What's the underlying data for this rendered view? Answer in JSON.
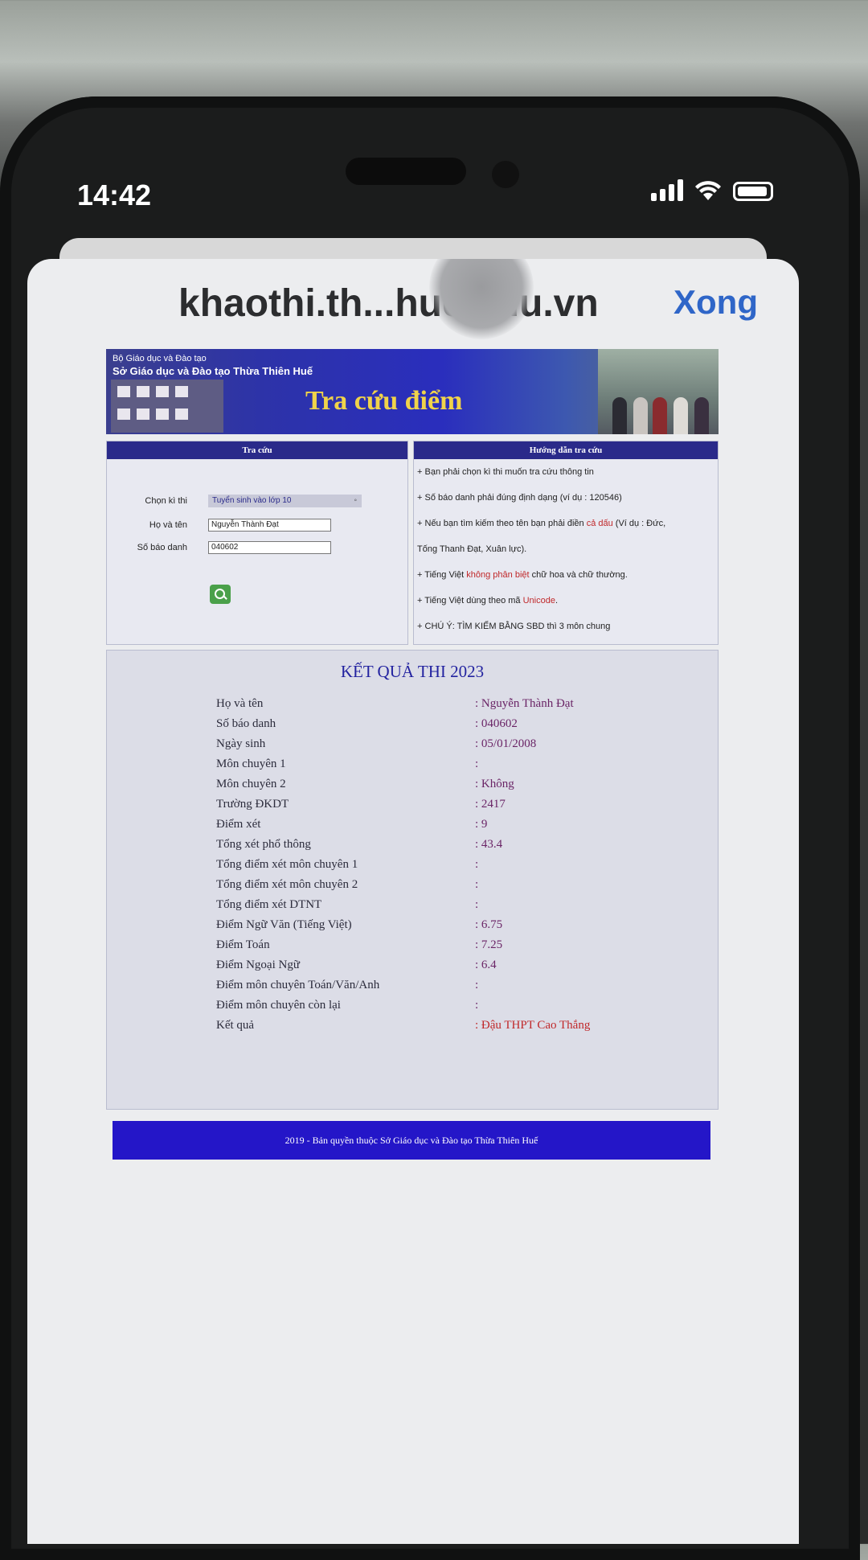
{
  "status_bar": {
    "time": "14:42"
  },
  "browser": {
    "url": "khaothi.th...hue.edu.vn",
    "done_label": "Xong"
  },
  "banner": {
    "ministry": "Bộ Giáo dục và  Đào tạo",
    "department": "Sở Giáo dục và Đào tạo Thừa Thiên Huế",
    "title": "Tra cứu điểm"
  },
  "search": {
    "header": "Tra cứu",
    "exam_label": "Chọn kì thi",
    "exam_value": "Tuyển sinh vào lớp 10",
    "name_label": "Họ và tên",
    "name_value": "Nguyễn Thành Đạt",
    "sbd_label": "Số báo danh",
    "sbd_value": "040602"
  },
  "guide": {
    "header": "Hướng dẫn tra cứu",
    "line1": "+ Bạn phải chọn kì thi muốn tra cứu thông tin",
    "line2": "+ Số báo danh phải đúng định dạng (ví dụ : 120546)",
    "line3a": "+ Nếu bạn tìm kiếm theo tên bạn phải điền ",
    "line3b": "cả dấu",
    "line3c": " (Ví dụ : Đức,",
    "line4": "Tống Thanh Đạt, Xuân lực).",
    "line5a": "+ Tiếng Việt ",
    "line5b": "không phân biệt",
    "line5c": " chữ hoa và chữ thường.",
    "line6a": "+ Tiếng Việt dùng theo mã ",
    "line6b": "Unicode",
    "line6c": ".",
    "line7": "+ CHÚ Ý: TÌM KIẾM BẰNG SBD thì 3 môn chung"
  },
  "result": {
    "title": "KẾT QUẢ THI 2023",
    "rows": [
      {
        "k": "Họ và tên",
        "v": ": Nguyễn Thành Đạt"
      },
      {
        "k": "Số báo danh",
        "v": ": 040602"
      },
      {
        "k": "Ngày sinh",
        "v": ": 05/01/2008"
      },
      {
        "k": "Môn chuyên 1",
        "v": ":"
      },
      {
        "k": "Môn chuyên 2",
        "v": ": Không"
      },
      {
        "k": "Trường ĐKDT",
        "v": ": 2417"
      },
      {
        "k": "Điểm xét",
        "v": ": 9"
      },
      {
        "k": "Tổng xét phổ thông",
        "v": ": 43.4"
      },
      {
        "k": "Tổng điểm xét môn chuyên 1",
        "v": ":"
      },
      {
        "k": "Tổng điểm xét môn chuyên 2",
        "v": ":"
      },
      {
        "k": "Tổng điểm xét DTNT",
        "v": ":"
      },
      {
        "k": "Điểm Ngữ Văn (Tiếng Việt)",
        "v": ": 6.75"
      },
      {
        "k": "Điểm Toán",
        "v": ": 7.25"
      },
      {
        "k": "Điểm Ngoại Ngữ",
        "v": ": 6.4"
      },
      {
        "k": "Điểm môn chuyên Toán/Văn/Anh",
        "v": ":"
      },
      {
        "k": "Điểm môn chuyên còn lại",
        "v": ":"
      },
      {
        "k": "Kết quả",
        "v": ": Đậu THPT Cao Thắng"
      }
    ]
  },
  "footer": "2019 - Bản quyền thuộc Sở Giáo dục và Đào tạo Thừa Thiên Huế"
}
